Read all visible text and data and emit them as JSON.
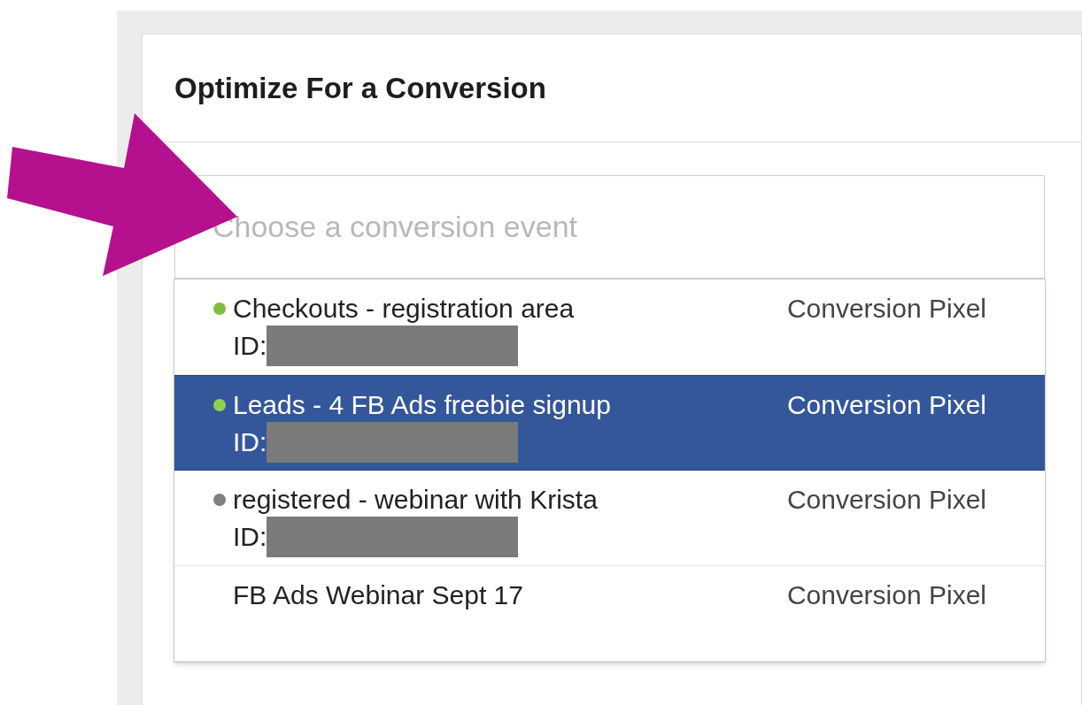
{
  "panel": {
    "title": "Optimize For a Conversion"
  },
  "event_field": {
    "placeholder": "Choose a conversion event"
  },
  "events": [
    {
      "name": "Checkouts - registration area",
      "id_label": "ID:",
      "type": "Conversion Pixel",
      "color": "#7fbf3f",
      "selected": false
    },
    {
      "name": "Leads - 4 FB Ads freebie signup",
      "id_label": "ID:",
      "type": "Conversion Pixel",
      "color": "#8fd14f",
      "selected": true
    },
    {
      "name": "registered - webinar with Krista",
      "id_label": "ID:",
      "type": "Conversion Pixel",
      "color": "#808080",
      "selected": false
    },
    {
      "name": "FB Ads Webinar Sept 17",
      "type": "Conversion Pixel",
      "selected": false
    }
  ]
}
